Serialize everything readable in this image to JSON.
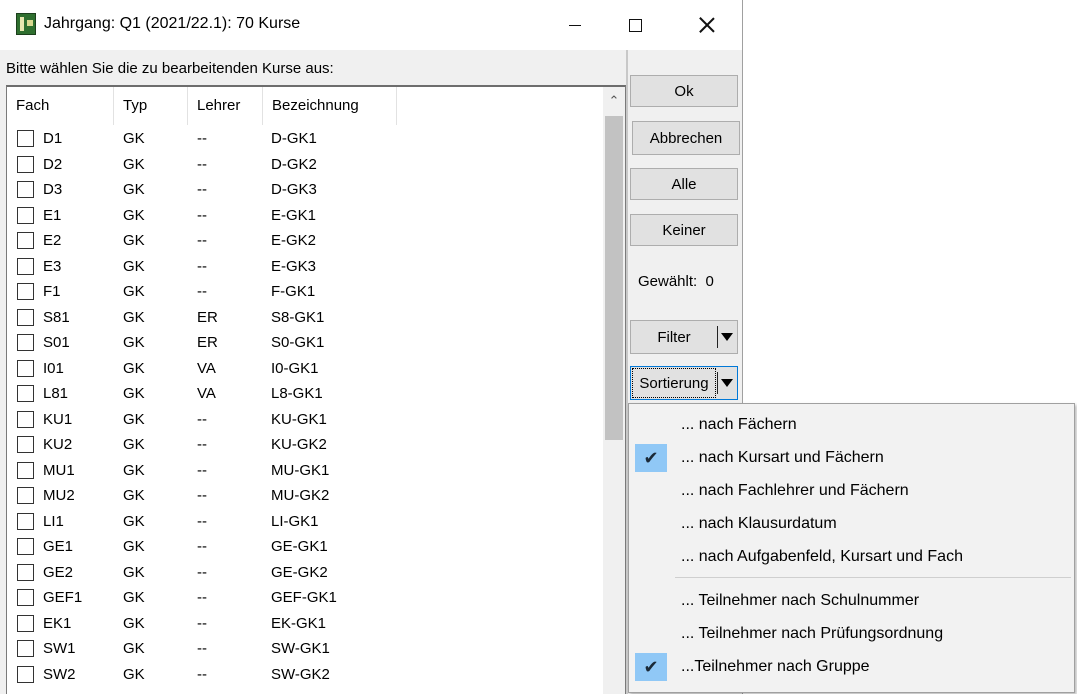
{
  "window": {
    "title": "Jahrgang: Q1 (2021/22.1): 70 Kurse"
  },
  "prompt": "Bitte wählen Sie die zu bearbeitenden Kurse aus:",
  "list": {
    "columns": [
      "Fach",
      "Typ",
      "Lehrer",
      "Bezeichnung"
    ],
    "rows": [
      {
        "fach": "D1",
        "typ": "GK",
        "lehrer": "--",
        "bez": "D-GK1",
        "checked": false
      },
      {
        "fach": "D2",
        "typ": "GK",
        "lehrer": "--",
        "bez": "D-GK2",
        "checked": false
      },
      {
        "fach": "D3",
        "typ": "GK",
        "lehrer": "--",
        "bez": "D-GK3",
        "checked": false
      },
      {
        "fach": "E1",
        "typ": "GK",
        "lehrer": "--",
        "bez": "E-GK1",
        "checked": false
      },
      {
        "fach": "E2",
        "typ": "GK",
        "lehrer": "--",
        "bez": "E-GK2",
        "checked": false
      },
      {
        "fach": "E3",
        "typ": "GK",
        "lehrer": "--",
        "bez": "E-GK3",
        "checked": false
      },
      {
        "fach": "F1",
        "typ": "GK",
        "lehrer": "--",
        "bez": "F-GK1",
        "checked": false
      },
      {
        "fach": "S81",
        "typ": "GK",
        "lehrer": "ER",
        "bez": "S8-GK1",
        "checked": false
      },
      {
        "fach": "S01",
        "typ": "GK",
        "lehrer": "ER",
        "bez": "S0-GK1",
        "checked": false
      },
      {
        "fach": "I01",
        "typ": "GK",
        "lehrer": "VA",
        "bez": "I0-GK1",
        "checked": false
      },
      {
        "fach": "L81",
        "typ": "GK",
        "lehrer": "VA",
        "bez": "L8-GK1",
        "checked": false
      },
      {
        "fach": "KU1",
        "typ": "GK",
        "lehrer": "--",
        "bez": "KU-GK1",
        "checked": false
      },
      {
        "fach": "KU2",
        "typ": "GK",
        "lehrer": "--",
        "bez": "KU-GK2",
        "checked": false
      },
      {
        "fach": "MU1",
        "typ": "GK",
        "lehrer": "--",
        "bez": "MU-GK1",
        "checked": false
      },
      {
        "fach": "MU2",
        "typ": "GK",
        "lehrer": "--",
        "bez": "MU-GK2",
        "checked": false
      },
      {
        "fach": "LI1",
        "typ": "GK",
        "lehrer": "--",
        "bez": "LI-GK1",
        "checked": false
      },
      {
        "fach": "GE1",
        "typ": "GK",
        "lehrer": "--",
        "bez": "GE-GK1",
        "checked": false
      },
      {
        "fach": "GE2",
        "typ": "GK",
        "lehrer": "--",
        "bez": "GE-GK2",
        "checked": false
      },
      {
        "fach": "GEF1",
        "typ": "GK",
        "lehrer": "--",
        "bez": "GEF-GK1",
        "checked": false
      },
      {
        "fach": "EK1",
        "typ": "GK",
        "lehrer": "--",
        "bez": "EK-GK1",
        "checked": false
      },
      {
        "fach": "SW1",
        "typ": "GK",
        "lehrer": "--",
        "bez": "SW-GK1",
        "checked": false
      },
      {
        "fach": "SW2",
        "typ": "GK",
        "lehrer": "--",
        "bez": "SW-GK2",
        "checked": false
      }
    ]
  },
  "buttons": {
    "ok": "Ok",
    "abbrechen": "Abbrechen",
    "alle": "Alle",
    "keiner": "Keiner",
    "filter": "Filter",
    "sortierung": "Sortierung"
  },
  "gewaehlt": {
    "label": "Gewählt:",
    "count": "0"
  },
  "sort_menu": {
    "items": [
      {
        "label": "... nach Fächern",
        "checked": false
      },
      {
        "label": "... nach Kursart und Fächern",
        "checked": true
      },
      {
        "label": "... nach Fachlehrer und Fächern",
        "checked": false
      },
      {
        "label": "... nach Klausurdatum",
        "checked": false
      },
      {
        "label": "... nach Aufgabenfeld, Kursart und Fach",
        "checked": false
      },
      {
        "label": "... Teilnehmer nach Schulnummer",
        "checked": false
      },
      {
        "label": "... Teilnehmer nach Prüfungsordnung",
        "checked": false
      },
      {
        "label": "...Teilnehmer nach Gruppe",
        "checked": true
      }
    ]
  },
  "colors": {
    "window_bg": "#f0f0f0",
    "button_bg": "#e1e1e1",
    "menu_bg": "#f2f2f2",
    "check_highlight": "#90c8f6",
    "focus_border": "#0078d7"
  }
}
